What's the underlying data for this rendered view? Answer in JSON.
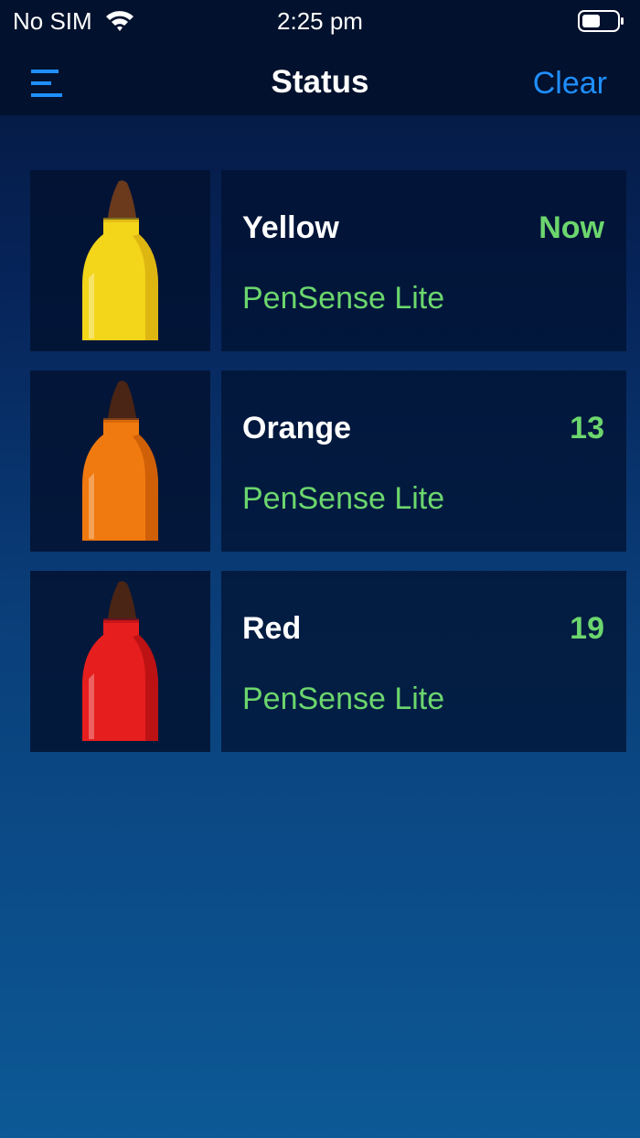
{
  "status_bar": {
    "carrier": "No SIM",
    "time": "2:25 pm",
    "wifi_icon": "wifi-icon",
    "battery_icon": "battery-icon"
  },
  "nav": {
    "title": "Status",
    "menu_icon": "menu-icon",
    "clear_label": "Clear"
  },
  "pens": [
    {
      "name": "Yellow",
      "last_seen": "Now",
      "model": "PenSense Lite",
      "body_color": "#f3d51a",
      "body_shade": "#d8ae0f",
      "tip_color": "#6b3a1d"
    },
    {
      "name": "Orange",
      "last_seen": "13",
      "model": "PenSense Lite",
      "body_color": "#f07a10",
      "body_shade": "#c85a05",
      "tip_color": "#4a2414"
    },
    {
      "name": "Red",
      "last_seen": "19",
      "model": "PenSense Lite",
      "body_color": "#e61e1e",
      "body_shade": "#b30f12",
      "tip_color": "#4a2414"
    }
  ],
  "colors": {
    "accent": "#1f8fff",
    "status_green": "#6cd66d",
    "nav_background": "#02112d"
  }
}
